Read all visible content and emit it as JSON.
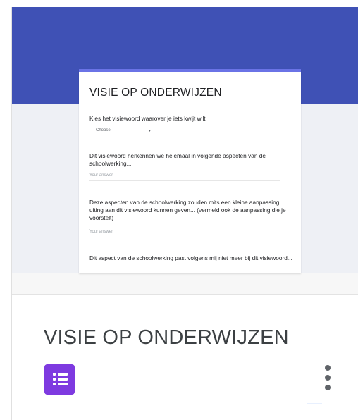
{
  "colors": {
    "header": "#3f51b5",
    "accent": "#6a73e6",
    "forms_icon": "#7e3ae0"
  },
  "thumbnail": {
    "form_title": "VISIE OP ONDERWIJZEN",
    "questions": [
      {
        "text": "Kies het visiewoord waarover je iets kwijt wilt",
        "dropdown_value": "Choose",
        "dropdown_caret": "▾"
      },
      {
        "text": "Dit visiewoord herkennen we helemaal in volgende aspecten van de schoolwerking...",
        "answer_placeholder": "Your answer"
      },
      {
        "text": "Deze aspecten van de schoolwerking zouden mits een kleine aanpassing uiting aan dit visiewoord kunnen geven... (vermeld ook de aanpassing die je voorstelt)",
        "answer_placeholder": "Your answer"
      },
      {
        "text": "Dit aspect van de schoolwerking past volgens mij niet meer bij dit visiewoord..."
      }
    ]
  },
  "card": {
    "title": "VISIE OP ONDERWIJZEN",
    "app_icon": "google-forms-icon",
    "menu_icon": "more-vert-icon"
  }
}
